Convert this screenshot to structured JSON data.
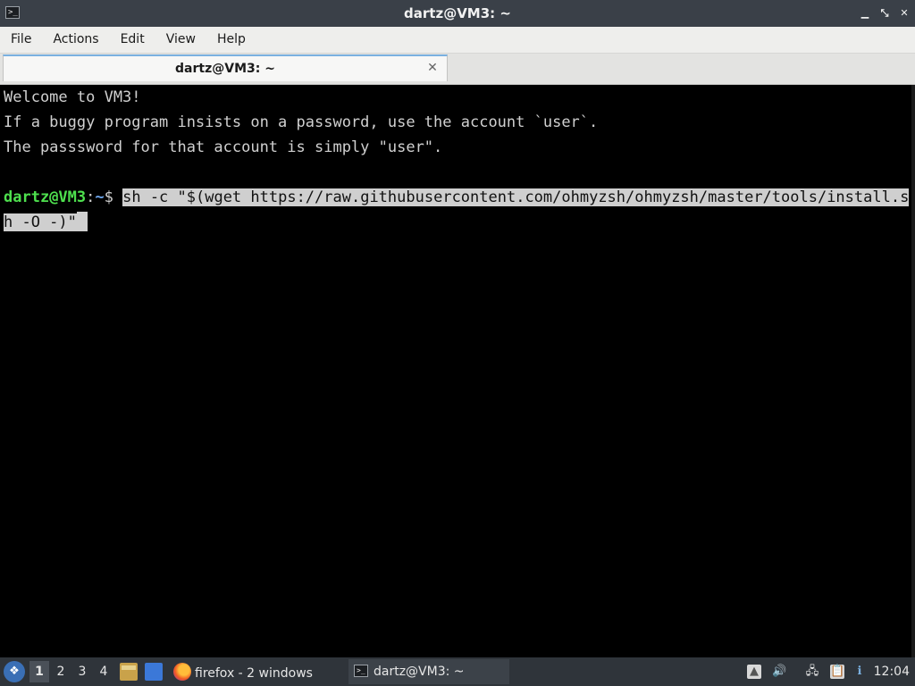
{
  "window": {
    "title": "dartz@VM3: ~",
    "app_icon_glyph": ">_",
    "controls": {
      "minimize": "▁",
      "maximize": "⤡",
      "close": "✕"
    }
  },
  "menu": [
    "File",
    "Actions",
    "Edit",
    "View",
    "Help"
  ],
  "tabs": [
    {
      "label": "dartz@VM3: ~",
      "close_glyph": "✕"
    }
  ],
  "terminal": {
    "lines": [
      "Welcome to VM3!",
      "If a buggy program insists on a password, use the account `user`.",
      "The passsword for that account is simply \"user\"."
    ],
    "prompt": {
      "user_host": "dartz@VM3",
      "colon": ":",
      "path": "~",
      "symbol": "$ "
    },
    "command_line1": "sh -c \"$(wget https://raw.githubusercontent.com/ohmyzsh/ohmyzsh/master/tools/install.s",
    "command_line2": "h -O -)\"",
    "colors": {
      "prompt_user": "#4ee04e",
      "prompt_path": "#6ea8f0",
      "selection": "#cfcfcf"
    }
  },
  "taskbar": {
    "start_glyph": "❖",
    "desktops": [
      "1",
      "2",
      "3",
      "4"
    ],
    "active_desktop": "1",
    "tasks": [
      {
        "label": "firefox - 2 windows",
        "icon": "firefox-icon"
      },
      {
        "label": "dartz@VM3: ~",
        "icon": "terminal-icon"
      }
    ],
    "tray": {
      "battery": "▲",
      "volume": "🔊",
      "network": "🖧",
      "clipboard": "📋",
      "info": "ℹ"
    },
    "clock": "12:04"
  }
}
